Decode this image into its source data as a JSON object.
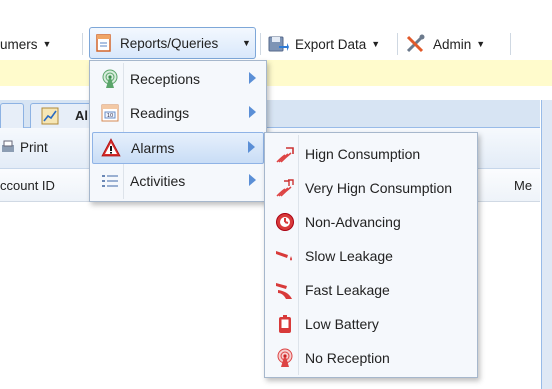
{
  "menubar": {
    "items": [
      {
        "label": "umers"
      },
      {
        "label": "Reports/Queries"
      },
      {
        "label": "Export Data"
      },
      {
        "label": "Admin"
      }
    ]
  },
  "tabs": [
    {
      "label": "Al"
    }
  ],
  "toolbar": {
    "print_label": "Print"
  },
  "grid": {
    "columns": [
      "ccount ID",
      "Me"
    ]
  },
  "reports_menu": {
    "items": [
      {
        "label": "Receptions",
        "icon": "antenna-icon"
      },
      {
        "label": "Readings",
        "icon": "meter-icon"
      },
      {
        "label": "Alarms",
        "icon": "warning-icon"
      },
      {
        "label": "Activities",
        "icon": "list-icon"
      }
    ]
  },
  "alarms_menu": {
    "items": [
      {
        "label": "Hign Consumption",
        "icon": "high-consumption-icon"
      },
      {
        "label": "Very Hign Consumption",
        "icon": "very-high-consumption-icon"
      },
      {
        "label": "Non-Advancing",
        "icon": "stop-icon"
      },
      {
        "label": "Slow Leakage",
        "icon": "slow-leak-icon"
      },
      {
        "label": "Fast Leakage",
        "icon": "fast-leak-icon"
      },
      {
        "label": "Low Battery",
        "icon": "battery-icon"
      },
      {
        "label": "No Reception",
        "icon": "no-reception-icon"
      }
    ]
  }
}
